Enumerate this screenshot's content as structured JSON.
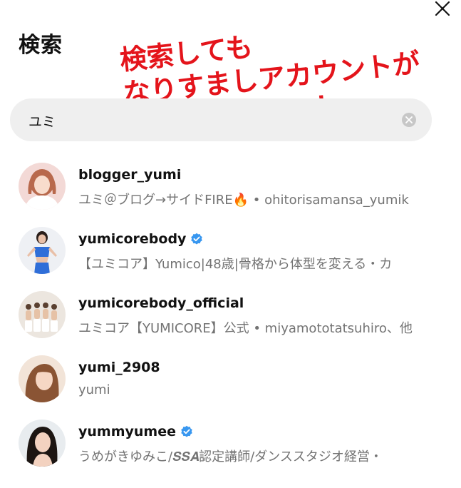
{
  "header": {
    "title": "検索"
  },
  "annotation": {
    "text": "検索しても\nなりすましアカウントが\nヒットしない…！"
  },
  "search": {
    "value": "ユミ"
  },
  "results": [
    {
      "username": "blogger_yumi",
      "subtitle": "ユミ＠ブログ→サイドFIRE🔥 • ohitorisamansa_yumik",
      "verified": false
    },
    {
      "username": "yumicorebody",
      "subtitle": "【ユミコア】Yumico|48歳|骨格から体型を変える・カ",
      "verified": true
    },
    {
      "username": "yumicorebody_official",
      "subtitle": "ユミコア【YUMICORE】公式 • miyamototatsuhiro、他",
      "verified": false
    },
    {
      "username": "yumi_2908",
      "subtitle": "yumi",
      "verified": false
    },
    {
      "username": "yummyumee",
      "subtitle": "うめがきゆみこ/𝑺𝑺𝑨認定講師/ダンススタジオ経営・",
      "verified": true
    }
  ],
  "colors": {
    "verified_badge": "#3897f0",
    "annotation": "#e4141b",
    "search_bg": "#efefef",
    "subtitle": "#737373"
  },
  "icons": {
    "close": "close-icon",
    "clear": "clear-icon",
    "verified": "verified-badge-icon"
  }
}
